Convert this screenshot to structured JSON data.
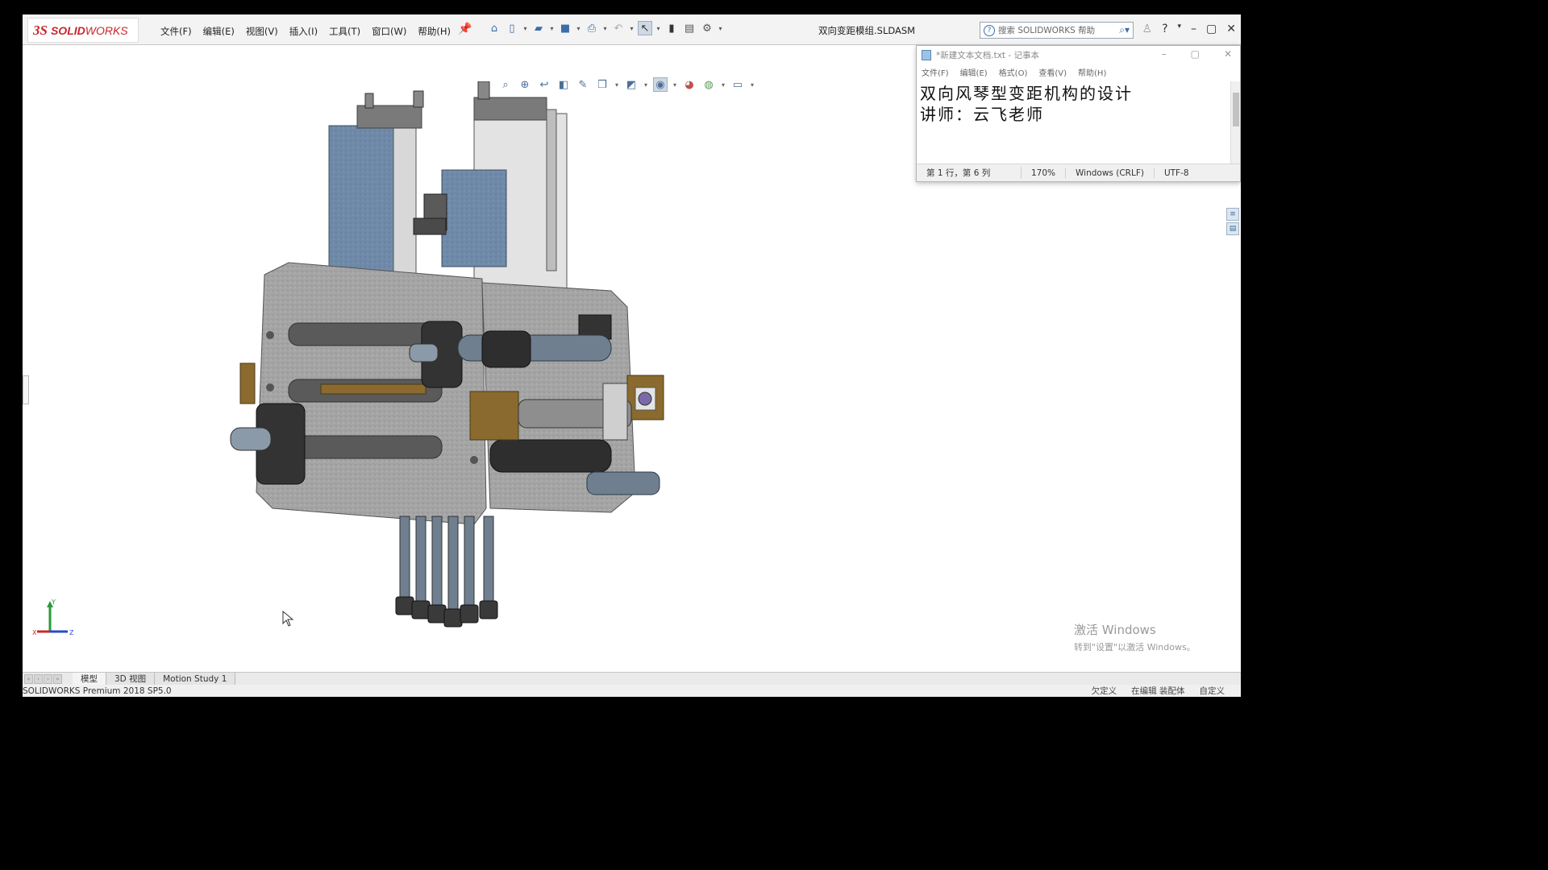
{
  "app": {
    "brand_prefix": "3S",
    "brand_bold": "SOLID",
    "brand_light": "WORKS",
    "document_title": "双向变距模组.SLDASM",
    "search_placeholder": "搜索 SOLIDWORKS 帮助"
  },
  "menu": [
    "文件(F)",
    "编辑(E)",
    "视图(V)",
    "插入(I)",
    "工具(T)",
    "窗口(W)",
    "帮助(H)"
  ],
  "notepad": {
    "title": "*新建文本文档.txt - 记事本",
    "menu": [
      "文件(F)",
      "编辑(E)",
      "格式(O)",
      "查看(V)",
      "帮助(H)"
    ],
    "lines": [
      "双向风琴型变距机构的设计",
      "",
      "讲师：云飞老师"
    ],
    "status": {
      "position": "第 1 行，第 6 列",
      "zoom": "170%",
      "line_ending": "Windows (CRLF)",
      "encoding": "UTF-8"
    }
  },
  "tabs": [
    "模型",
    "3D 视图",
    "Motion Study 1"
  ],
  "statusbar": {
    "left": "SOLIDWORKS Premium 2018 SP5.0",
    "right": [
      "欠定义",
      "在编辑 装配体",
      "自定义"
    ]
  },
  "watermark": {
    "line1": "激活 Windows",
    "line2": "转到\"设置\"以激活 Windows。"
  },
  "colors": {
    "brand_red": "#c8262c",
    "accent_blue": "#3b6ea8",
    "part_gray": "#9a9a9a",
    "part_blue": "#6f8aa8",
    "bracket_brown": "#8a6a2e"
  }
}
